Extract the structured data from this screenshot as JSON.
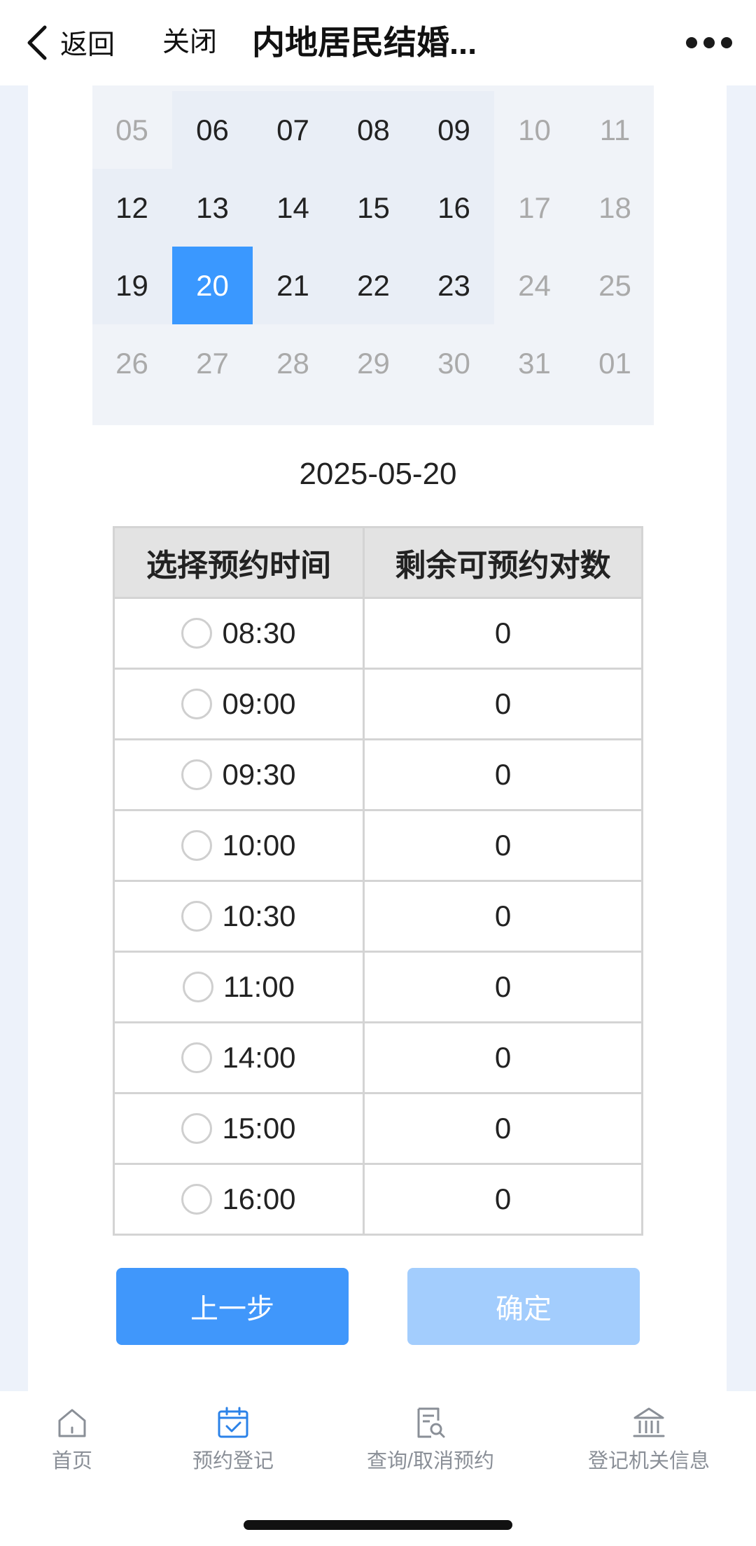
{
  "nav": {
    "back_label": "返回",
    "close_label": "关闭",
    "title": "内地居民结婚..."
  },
  "calendar": {
    "rows": [
      [
        {
          "day": "05",
          "available": false,
          "selected": false
        },
        {
          "day": "06",
          "available": true,
          "selected": false
        },
        {
          "day": "07",
          "available": true,
          "selected": false
        },
        {
          "day": "08",
          "available": true,
          "selected": false
        },
        {
          "day": "09",
          "available": true,
          "selected": false
        },
        {
          "day": "10",
          "available": false,
          "selected": false
        },
        {
          "day": "11",
          "available": false,
          "selected": false
        }
      ],
      [
        {
          "day": "12",
          "available": true,
          "selected": false
        },
        {
          "day": "13",
          "available": true,
          "selected": false
        },
        {
          "day": "14",
          "available": true,
          "selected": false
        },
        {
          "day": "15",
          "available": true,
          "selected": false
        },
        {
          "day": "16",
          "available": true,
          "selected": false
        },
        {
          "day": "17",
          "available": false,
          "selected": false
        },
        {
          "day": "18",
          "available": false,
          "selected": false
        }
      ],
      [
        {
          "day": "19",
          "available": true,
          "selected": false
        },
        {
          "day": "20",
          "available": true,
          "selected": true
        },
        {
          "day": "21",
          "available": true,
          "selected": false
        },
        {
          "day": "22",
          "available": true,
          "selected": false
        },
        {
          "day": "23",
          "available": true,
          "selected": false
        },
        {
          "day": "24",
          "available": false,
          "selected": false
        },
        {
          "day": "25",
          "available": false,
          "selected": false
        }
      ],
      [
        {
          "day": "26",
          "available": false,
          "selected": false
        },
        {
          "day": "27",
          "available": false,
          "selected": false
        },
        {
          "day": "28",
          "available": false,
          "selected": false
        },
        {
          "day": "29",
          "available": false,
          "selected": false
        },
        {
          "day": "30",
          "available": false,
          "selected": false
        },
        {
          "day": "31",
          "available": false,
          "selected": false
        },
        {
          "day": "01",
          "available": false,
          "selected": false
        }
      ]
    ]
  },
  "selected_date": "2025-05-20",
  "table": {
    "headers": [
      "选择预约时间",
      "剩余可预约对数"
    ],
    "rows": [
      {
        "time": "08:30",
        "remaining": "0"
      },
      {
        "time": "09:00",
        "remaining": "0"
      },
      {
        "time": "09:30",
        "remaining": "0"
      },
      {
        "time": "10:00",
        "remaining": "0"
      },
      {
        "time": "10:30",
        "remaining": "0"
      },
      {
        "time": "11:00",
        "remaining": "0"
      },
      {
        "time": "14:00",
        "remaining": "0"
      },
      {
        "time": "15:00",
        "remaining": "0"
      },
      {
        "time": "16:00",
        "remaining": "0"
      }
    ]
  },
  "buttons": {
    "prev": "上一步",
    "confirm": "确定"
  },
  "tabbar": {
    "items": [
      {
        "label": "首页",
        "icon": "home-icon"
      },
      {
        "label": "预约登记",
        "icon": "calendar-check-icon"
      },
      {
        "label": "查询/取消预约",
        "icon": "document-search-icon"
      },
      {
        "label": "登记机关信息",
        "icon": "building-icon"
      }
    ]
  },
  "colors": {
    "accent": "#3a98ff",
    "button_primary": "#4097fb",
    "button_disabled": "#a3cdfd",
    "page_bg": "#edf2fa",
    "calendar_bg": "#f0f3f8"
  }
}
